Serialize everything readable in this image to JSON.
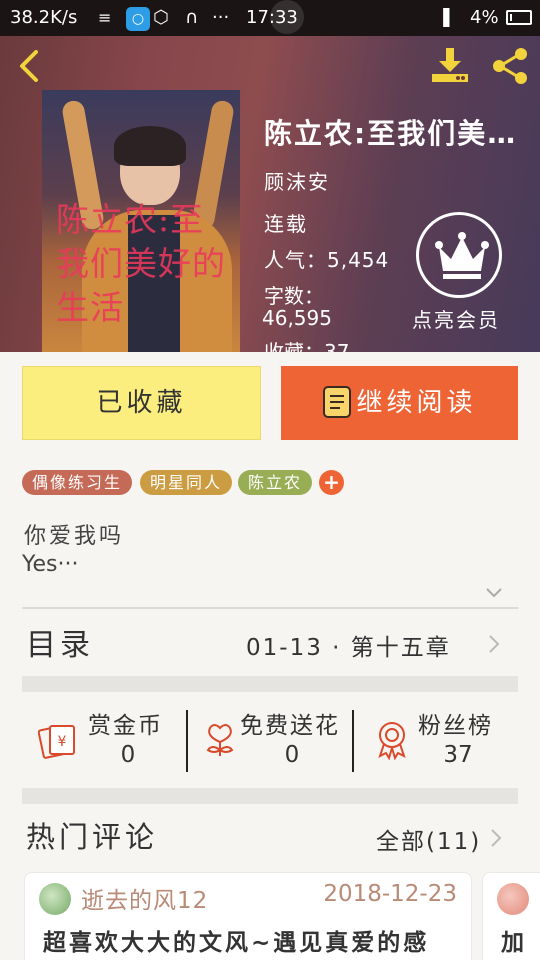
{
  "status_bar": {
    "net_speed": "38.2K/s",
    "dots": "···",
    "time": "17:33",
    "battery": "4%"
  },
  "book": {
    "cover_text": "陈立农:至我们美好的生活",
    "title": "陈立农:至我们美…",
    "author": "顾沫安",
    "status": "连载",
    "popularity": "人气：5,454",
    "words_label": "字数：",
    "words_value": "46,595",
    "favorites": "收藏：37"
  },
  "vip": {
    "label": "点亮会员"
  },
  "actions": {
    "favorited_label": "已收藏",
    "read_label": "继续阅读"
  },
  "tags": [
    "偶像练习生",
    "明星同人",
    "陈立农"
  ],
  "tag_add": "+",
  "intro": {
    "line1": "你爱我吗",
    "line2": "Yes···"
  },
  "toc": {
    "label": "目录",
    "latest": "01-13 · 第十五章"
  },
  "stats": [
    {
      "label": "赏金币",
      "value": "0"
    },
    {
      "label": "免费送花",
      "value": "0"
    },
    {
      "label": "粉丝榜",
      "value": "37"
    }
  ],
  "comments": {
    "heading": "热门评论",
    "all_label": "全部(11)",
    "items": [
      {
        "user": "逝去的风12",
        "date": "2018-12-23",
        "text": "超喜欢大大的文风~遇见真爱的感"
      },
      {
        "text": "加"
      }
    ]
  },
  "colors": {
    "accent": "#ef6435",
    "favorite_button": "#fbee7e",
    "tag_1": "#c46a57",
    "tag_2": "#cc9c43",
    "tag_3": "#99ad55",
    "icon_gold": "#f3d33b",
    "icon_red": "#d84a2b"
  },
  "icons": [
    "back-arrow-icon",
    "download-icon",
    "share-icon",
    "crown-icon",
    "book-icon",
    "red-envelope-icon",
    "flower-icon",
    "medal-icon",
    "chevron-right-icon",
    "chevron-down-icon"
  ]
}
